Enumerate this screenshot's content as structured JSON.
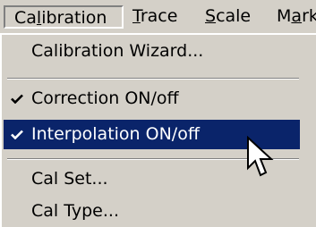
{
  "menubar": {
    "items": [
      {
        "pre": "Ca",
        "key": "l",
        "post": "ibration"
      },
      {
        "pre": "",
        "key": "T",
        "post": "race"
      },
      {
        "pre": "",
        "key": "S",
        "post": "cale"
      },
      {
        "pre": "M",
        "key": "a",
        "post": "rk"
      }
    ]
  },
  "menu": {
    "calibration_wizard": "Calibration Wizard...",
    "correction": "Correction ON/off",
    "interpolation": "Interpolation ON/off",
    "cal_set": "Cal Set...",
    "cal_type": "Cal Type..."
  },
  "colors": {
    "menu_bg": "#d4d0c8",
    "highlight_bg": "#0a246a",
    "highlight_fg": "#ffffff"
  },
  "icons": {
    "check": "check-icon",
    "cursor": "mouse-pointer-icon"
  }
}
